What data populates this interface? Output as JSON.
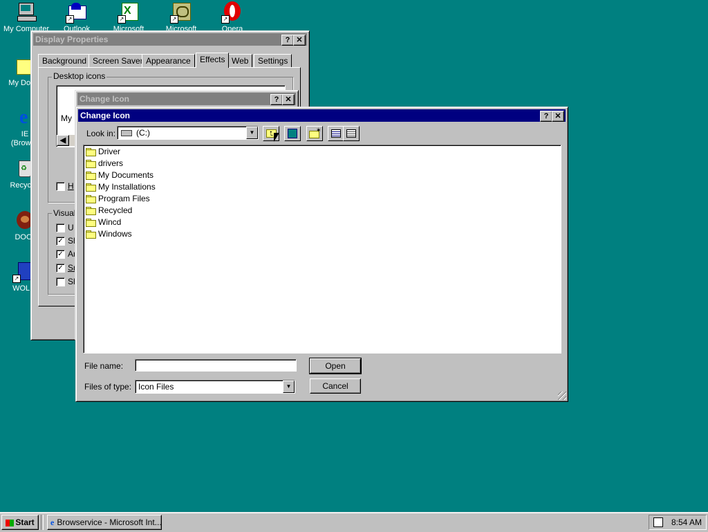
{
  "desktop": {
    "icons": [
      {
        "label": "My Computer",
        "icon": "computer-icon"
      },
      {
        "label": "Outlook",
        "icon": "outlook-icon"
      },
      {
        "label": "Microsoft",
        "icon": "excel-icon"
      },
      {
        "label": "Microsoft",
        "icon": "project-icon"
      },
      {
        "label": "Opera",
        "icon": "opera-icon"
      },
      {
        "label": "My Docu",
        "icon": "folder-icon"
      },
      {
        "label": "IE",
        "label2": "(Browse",
        "icon": "ie-icon"
      },
      {
        "label": "Recycle",
        "icon": "recycle-bin-icon"
      },
      {
        "label": "DOO",
        "icon": "doom-icon"
      },
      {
        "label": "WOLF",
        "icon": "wolf-icon"
      }
    ]
  },
  "display_properties": {
    "title": "Display Properties",
    "tabs": [
      "Background",
      "Screen Saver",
      "Appearance",
      "Effects",
      "Web",
      "Settings"
    ],
    "selected_tab": "Effects",
    "desktop_icons_group": "Desktop icons",
    "icon_preview_label": "My I",
    "hide_checkbox_label": "H",
    "visual_group": "Visual",
    "visual_checks": [
      {
        "label": "U",
        "checked": false
      },
      {
        "label": "Sh",
        "checked": true
      },
      {
        "label": "Ar",
        "checked": true
      },
      {
        "label": "Sr",
        "checked": true
      },
      {
        "label": "Sh",
        "checked": false
      }
    ]
  },
  "change_icon_back": {
    "title": "Change Icon"
  },
  "change_icon": {
    "title": "Change Icon",
    "help_glyph": "?",
    "close_glyph": "✕",
    "look_in_label": "Look in:",
    "look_in_value": "(C:)",
    "files": [
      "Driver",
      "drivers",
      "My Documents",
      "My Installations",
      "Program Files",
      "Recycled",
      "Wincd",
      "Windows"
    ],
    "file_name_label": "File name:",
    "file_name_value": "",
    "files_of_type_label": "Files of type:",
    "files_of_type_value": "Icon Files",
    "open_button": "Open",
    "cancel_button": "Cancel"
  },
  "taskbar": {
    "start_label": "Start",
    "task_label": "Browservice - Microsoft Int...",
    "clock": "8:54 AM"
  },
  "colors": {
    "desktop": "#008080",
    "active_title": "#000080",
    "inactive_title": "#808080",
    "face": "#c0c0c0"
  }
}
